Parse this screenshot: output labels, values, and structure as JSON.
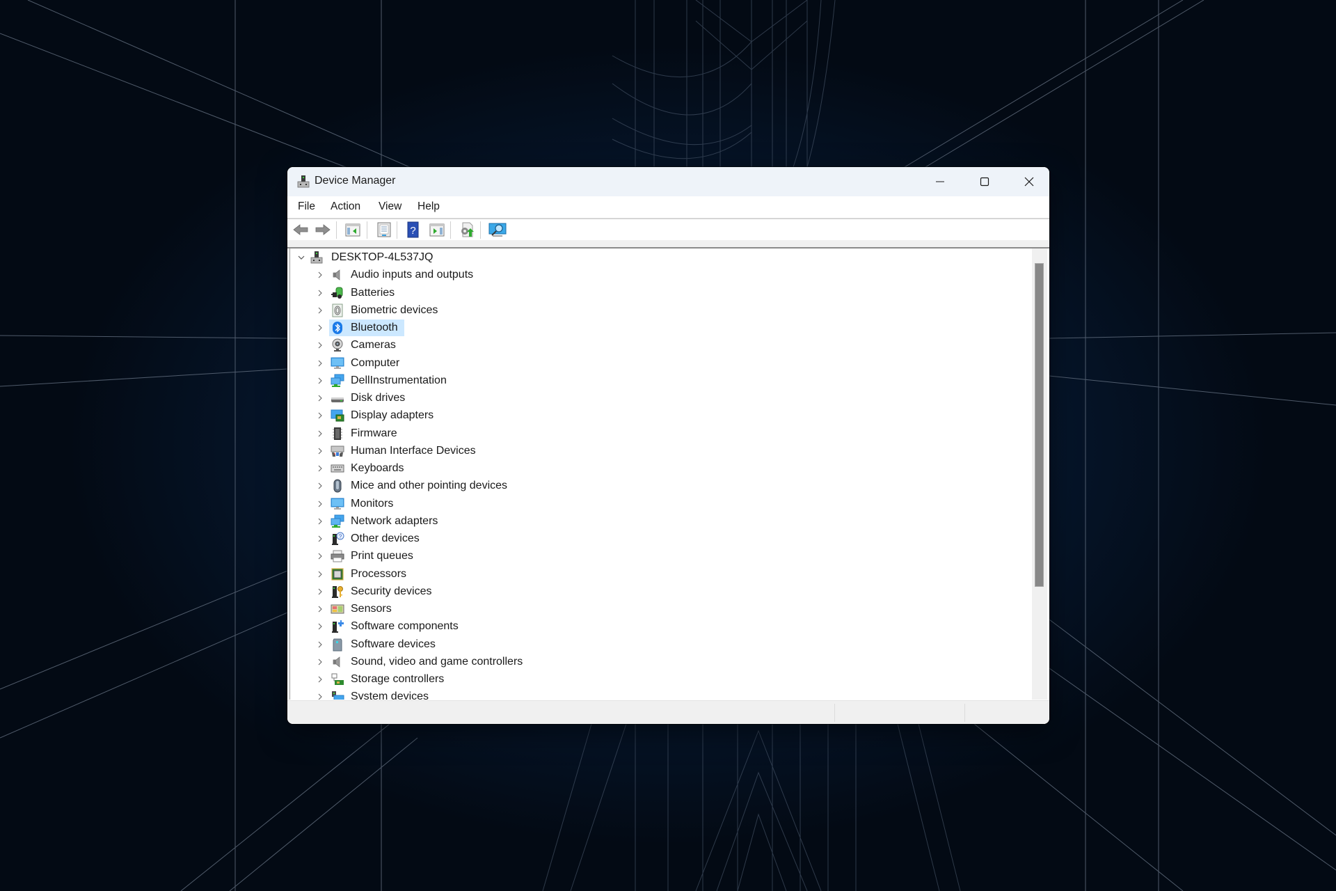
{
  "window": {
    "title": "Device Manager",
    "icon": "device-manager-icon",
    "controls": {
      "minimize": "minimize-icon",
      "maximize": "maximize-icon",
      "close": "close-icon"
    }
  },
  "menu": [
    {
      "label": "File"
    },
    {
      "label": "Action"
    },
    {
      "label": "View"
    },
    {
      "label": "Help"
    }
  ],
  "toolbar": [
    {
      "name": "back",
      "icon": "back-arrow-icon",
      "tooltip": "Back"
    },
    {
      "name": "forward",
      "icon": "forward-arrow-icon",
      "tooltip": "Forward"
    },
    {
      "name": "show-hide-console-tree",
      "icon": "console-tree-icon",
      "tooltip": "Show/Hide Console Tree"
    },
    {
      "name": "properties",
      "icon": "properties-icon",
      "tooltip": "Properties"
    },
    {
      "name": "help",
      "icon": "help-icon",
      "tooltip": "Help"
    },
    {
      "name": "show-hide-action-pane",
      "icon": "action-pane-icon",
      "tooltip": "Show/Hide Action Pane"
    },
    {
      "name": "update-driver",
      "icon": "update-driver-icon",
      "tooltip": "Update Driver"
    },
    {
      "name": "scan-hardware",
      "icon": "scan-hardware-icon",
      "tooltip": "Scan for hardware changes"
    }
  ],
  "tree": {
    "root": {
      "label": "DESKTOP-4L537JQ",
      "expanded": true,
      "icon": "computer-root-icon"
    },
    "selected_index": 3,
    "items": [
      {
        "label": "Audio inputs and outputs",
        "icon": "speaker-icon"
      },
      {
        "label": "Batteries",
        "icon": "battery-icon"
      },
      {
        "label": "Biometric devices",
        "icon": "fingerprint-icon"
      },
      {
        "label": "Bluetooth",
        "icon": "bluetooth-icon"
      },
      {
        "label": "Cameras",
        "icon": "webcam-icon"
      },
      {
        "label": "Computer",
        "icon": "monitor-icon"
      },
      {
        "label": "DellInstrumentation",
        "icon": "network-monitors-icon"
      },
      {
        "label": "Disk drives",
        "icon": "disk-drive-icon"
      },
      {
        "label": "Display adapters",
        "icon": "display-adapter-icon"
      },
      {
        "label": "Firmware",
        "icon": "chip-icon"
      },
      {
        "label": "Human Interface Devices",
        "icon": "hid-icon"
      },
      {
        "label": "Keyboards",
        "icon": "keyboard-icon"
      },
      {
        "label": "Mice and other pointing devices",
        "icon": "mouse-icon"
      },
      {
        "label": "Monitors",
        "icon": "monitor-icon"
      },
      {
        "label": "Network adapters",
        "icon": "network-monitors-icon"
      },
      {
        "label": "Other devices",
        "icon": "unknown-device-icon"
      },
      {
        "label": "Print queues",
        "icon": "printer-icon"
      },
      {
        "label": "Processors",
        "icon": "processor-icon"
      },
      {
        "label": "Security devices",
        "icon": "security-key-icon"
      },
      {
        "label": "Sensors",
        "icon": "sensor-icon"
      },
      {
        "label": "Software components",
        "icon": "software-component-icon"
      },
      {
        "label": "Software devices",
        "icon": "software-device-icon"
      },
      {
        "label": "Sound, video and game controllers",
        "icon": "speaker-icon"
      },
      {
        "label": "Storage controllers",
        "icon": "storage-controller-icon"
      },
      {
        "label": "System devices",
        "icon": "system-devices-icon"
      }
    ]
  },
  "statusbar": {
    "panes": [
      "",
      "",
      ""
    ]
  },
  "colors": {
    "selection": "#cce8ff",
    "titlebar": "#eef3f9",
    "desktop": "#030a14"
  }
}
